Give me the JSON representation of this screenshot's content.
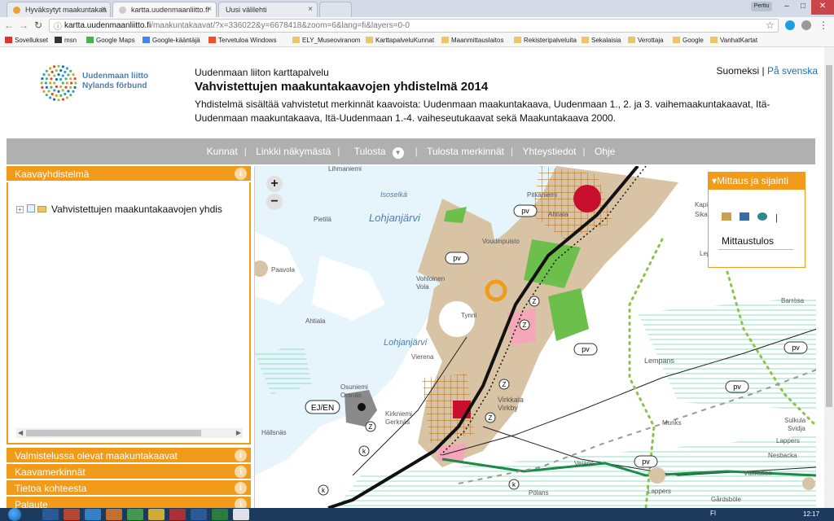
{
  "browser": {
    "tabs": [
      {
        "label": "Hyväksytyt maakuntakaa",
        "active": false,
        "favicon_color": "#e8a23a"
      },
      {
        "label": "kartta.uudenmaanliitto.fi",
        "active": true,
        "favicon_color": "#cccccc"
      },
      {
        "label": "Uusi välilehti",
        "active": false,
        "favicon_color": "#cccccc"
      }
    ],
    "user_chip": "Perttu",
    "url_host": "kartta.uudenmaanliitto.fi",
    "url_path": "/maakuntakaavat/?x=336022&y=6678418&zoom=6&lang=fi&layers=0-0",
    "bookmarks": [
      "Sovellukset",
      "msn",
      "Google Maps",
      "Google-kääntäjä",
      "Tervetuloa Windows",
      "ELY_Museoviranom",
      "KarttapalveluKunnat",
      "Maanmittauslaitos",
      "Rekisteripalveluita",
      "Sekalaisia",
      "Verottaja",
      "Google",
      "VanhatKartat"
    ]
  },
  "header": {
    "logo_line1": "Uudenmaan liitto",
    "logo_line2": "Nylands förbund",
    "site_name": "Uudenmaan liiton karttapalvelu",
    "title": "Vahvistettujen maakuntakaavojen yhdistelmä 2014",
    "description": "Yhdistelmä sisältää vahvistetut merkinnät kaavoista: Uudenmaan maakuntakaava, Uudenmaan 1., 2. ja 3. vaihemaakuntakaavat, Itä-Uudenmaan maakuntakaava, Itä-Uudenmaan 1.-4. vaiheseutukaavat sekä Maakuntakaava 2000.",
    "lang_current": "Suomeksi",
    "lang_separator": "|",
    "lang_other": "På svenska"
  },
  "menu": {
    "items": [
      "Kunnat",
      "Linkki näkymästä",
      "Tulosta",
      "Tulosta merkinnät",
      "Yhteystiedot",
      "Ohje"
    ],
    "separator": "|",
    "dropdown_glyph": "▼"
  },
  "panel": {
    "info_glyph": "i",
    "sections": [
      "Kaavayhdistelmä",
      "Valmistelussa olevat maakuntakaavat",
      "Kaavamerkinnät",
      "Tietoa kohteesta",
      "Palaute"
    ],
    "tree_item": "Vahvistettujen maakuntakaavojen yhdis",
    "tree_expander": "+"
  },
  "map": {
    "zoom_in": "+",
    "zoom_out": "−",
    "place_labels": [
      "Lohjanjärvi",
      "Lohjanjärvi",
      "Isoselkä",
      "Pietilä",
      "Paavola",
      "Ahtiala",
      "Vohloinen",
      "Vola",
      "Voudinpuisto",
      "Pitkäniemi",
      "Ahtiala",
      "Tynni",
      "Vierena",
      "Osuniemi",
      "Orsnäs",
      "Kirkniemi",
      "Gerknäs",
      "Virkkala",
      "Virkby",
      "Hällsnäs",
      "Lempans",
      "Munks",
      "Lappers",
      "Barrösa",
      "Sulkula",
      "Svidja",
      "Leppäkorpi",
      "Pölans",
      "Nesbacka",
      "Gårdsböle",
      "Vejans",
      "Lihmaniemi",
      "Kapila",
      "Sikava",
      "Lappers",
      "Vätikullen"
    ],
    "symbol_labels": [
      "pv",
      "pv",
      "pv",
      "pv",
      "pv",
      "pv",
      "EJ/EN"
    ],
    "route_labels": [
      "Z",
      "Z",
      "Z",
      "Z",
      "Z",
      "k",
      "k",
      "k"
    ],
    "measure_panel": {
      "title": "Mittaus ja sijainti",
      "title_glyph": "▾",
      "result_label": "Mittaustulos",
      "cursor_glyph": "|"
    }
  },
  "taskbar": {
    "lang": "FI",
    "time": "12:17",
    "app_colors": [
      "#2b5fa0",
      "#d04a2a",
      "#3a8dd8",
      "#e27a2a",
      "#4ba84b",
      "#f0c030",
      "#c03030",
      "#2b5fa0",
      "#2a8a3a",
      "#ffffff"
    ]
  },
  "colors": {
    "accent": "#f29b1a",
    "menubar": "#b0b0b0",
    "link": "#1a6fb5",
    "water": "#e6f4fb",
    "urban": "#d8c3a5",
    "green": "#6cbf4a",
    "red": "#c8102e"
  }
}
